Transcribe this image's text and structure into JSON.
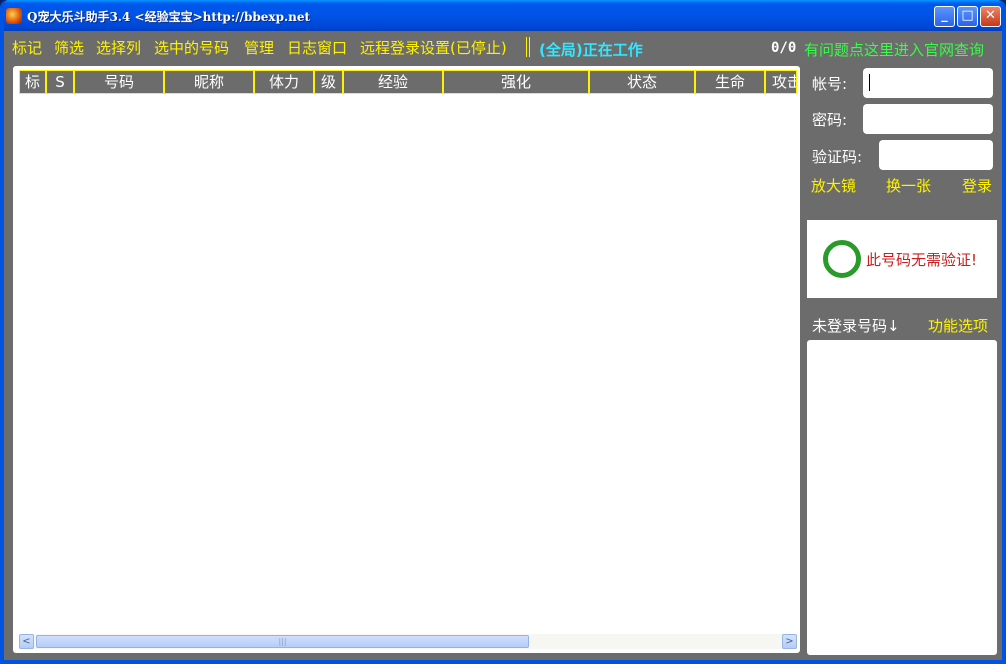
{
  "window": {
    "title": "Q宠大乐斗助手3.4 <经验宝宝>http://bbexp.net",
    "minimize_symbol": "_",
    "maximize_symbol": "□",
    "close_symbol": "✕"
  },
  "menu": {
    "items": [
      "标记",
      "筛选",
      "选择列",
      "选中的号码",
      "管理",
      "日志窗口",
      "远程登录设置(已停止)"
    ],
    "status": "(全局)正在工作",
    "counter": "0/0",
    "help_link": "有问题点这里进入官网查询"
  },
  "table": {
    "columns": [
      "标",
      "S",
      "号码",
      "昵称",
      "体力",
      "级",
      "经验",
      "强化",
      "状态",
      "生命",
      "攻击"
    ],
    "rows": [],
    "scrollbar": {
      "left_arrow": "<",
      "right_arrow": ">",
      "grip": "|||"
    }
  },
  "login": {
    "account_label": "帐号:",
    "account_value": "",
    "password_label": "密码:",
    "password_value": "",
    "captcha_label": "验证码:",
    "captcha_value": "",
    "magnifier_link": "放大镜",
    "refresh_link": "换一张",
    "login_link": "登录"
  },
  "captcha": {
    "message": "此号码无需验证!"
  },
  "unlogged": {
    "label": "未登录号码↓",
    "options_link": "功能选项",
    "items": []
  },
  "colors": {
    "menu_text": "#fff200",
    "status_text": "#33e6ff",
    "help_link": "#33ff44",
    "background": "#6c6c6c",
    "captcha_ok_ring": "#2a9a2a",
    "captcha_message": "#c81e1e"
  },
  "icons": {
    "app": "app-icon",
    "captcha_ok": "check-ring-icon"
  }
}
